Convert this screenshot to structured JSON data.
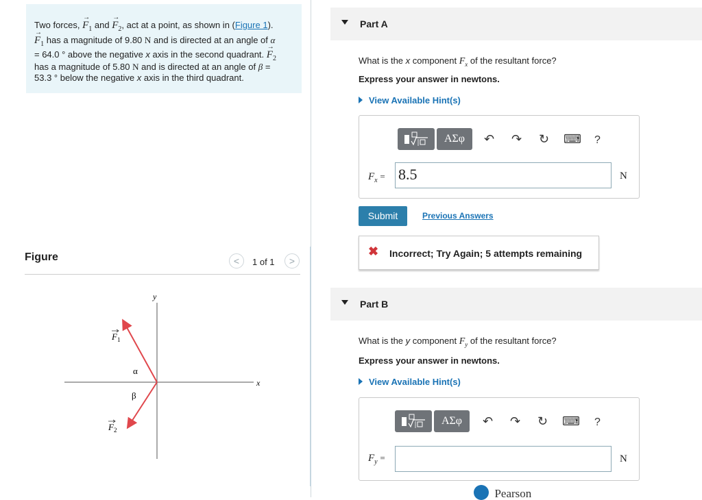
{
  "problem": {
    "line1_prefix": "Two forces,",
    "f1": "F",
    "f1_sub": "1",
    "and": "and",
    "f2": "F",
    "f2_sub": "2",
    "line1_mid": ", act at a point, as shown in (",
    "figure_link": "Figure 1",
    "line1_end": ").",
    "line2": "has a magnitude of 9.80",
    "unit_n": "N",
    "line2_end": "and is directed at an angle of",
    "alpha": "α",
    "line3": "= 64.0 ° above the negative",
    "x_axis_var": "x",
    "line3_end": "axis in the second quadrant.",
    "line4": "has a magnitude of 5.80",
    "line4_end": "and is directed at an angle of",
    "beta": "β",
    "line4_eq": "=",
    "line5": "53.3 ° below the negative",
    "line5_end": "axis in the third quadrant."
  },
  "figure": {
    "title": "Figure",
    "pager": "1 of 1",
    "prev_icon": "<",
    "next_icon": ">",
    "axis_x": "x",
    "axis_y": "y",
    "label_alpha": "α",
    "label_beta": "β",
    "label_f1": "F",
    "label_f1_sub": "1",
    "label_f2": "F",
    "label_f2_sub": "2",
    "vector_color": "#e0474c"
  },
  "toolbar": {
    "templates_icon": "fraction-root-template-icon",
    "symbols_label": "ΑΣφ",
    "undo_icon": "↶",
    "redo_icon": "↷",
    "reset_icon": "↻",
    "keyboard_icon": "⌨",
    "help_label": "?"
  },
  "part_a": {
    "title": "Part A",
    "question_prefix": "What is the",
    "question_var": "x",
    "question_mid": "component",
    "question_sym": "F",
    "question_sym_sub": "x",
    "question_end": "of the resultant force?",
    "instruction": "Express your answer in newtons.",
    "hint": "View Available Hint(s)",
    "input_label": "F",
    "input_label_sub": "x",
    "input_eq": "=",
    "input_value": "8.5",
    "unit": "N",
    "submit": "Submit",
    "previous_answers": "Previous Answers",
    "feedback_icon": "✖",
    "feedback": "Incorrect; Try Again; 5 attempts remaining"
  },
  "part_b": {
    "title": "Part B",
    "question_prefix": "What is the",
    "question_var": "y",
    "question_mid": "component",
    "question_sym": "F",
    "question_sym_sub": "y",
    "question_end": "of the resultant force?",
    "instruction": "Express your answer in newtons.",
    "hint": "View Available Hint(s)",
    "input_label": "F",
    "input_label_sub": "y",
    "input_eq": "=",
    "input_value": "",
    "unit": "N"
  },
  "footer": {
    "brand": "Pearson",
    "brand_color": "#1a73b5"
  }
}
